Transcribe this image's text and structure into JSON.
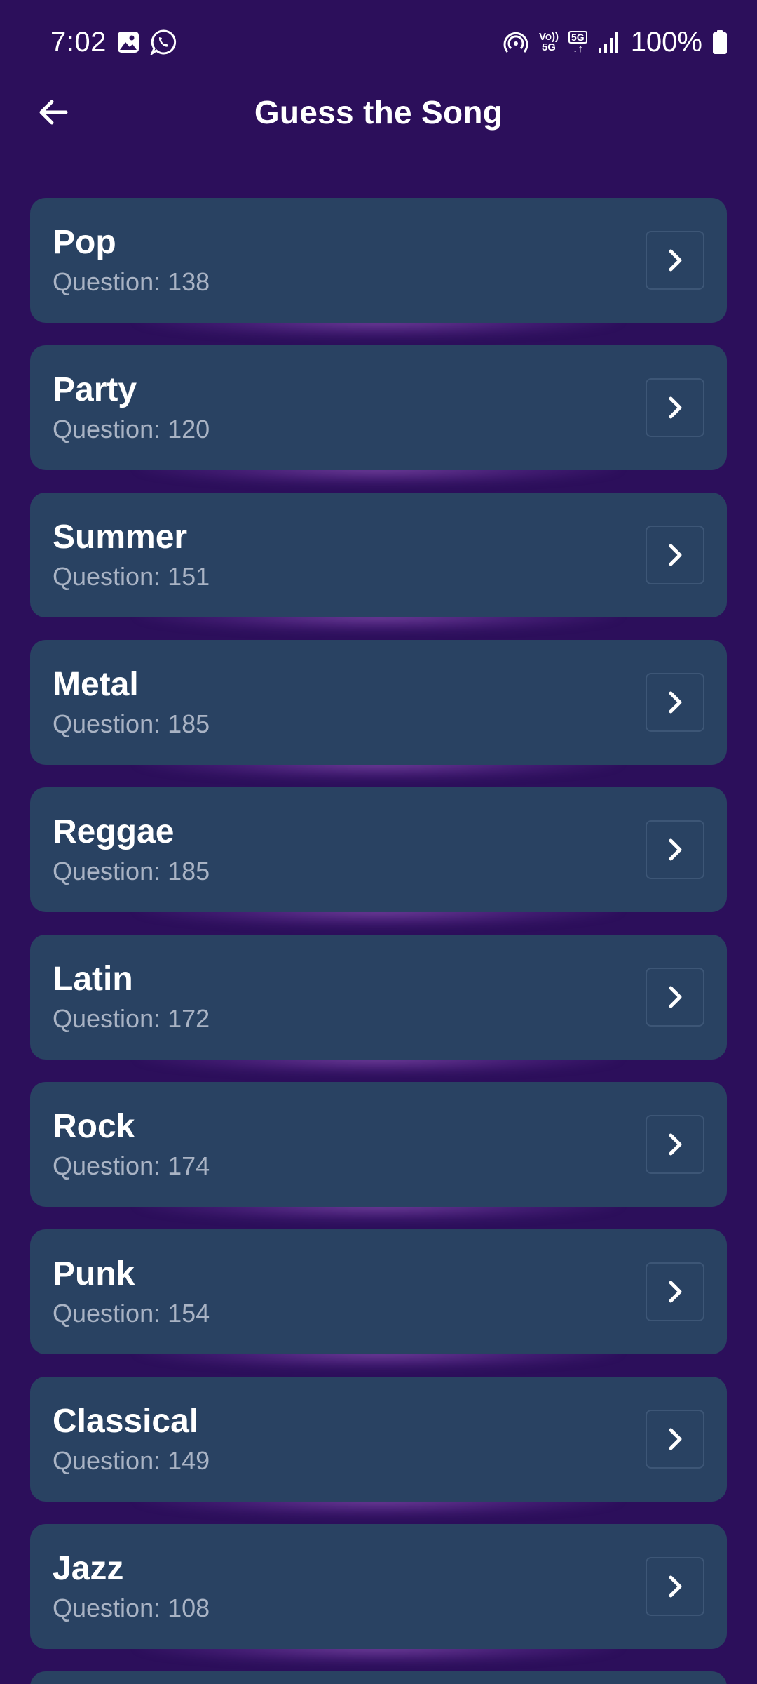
{
  "status_bar": {
    "time": "7:02",
    "battery_text": "100%",
    "volte_top": "Vo))",
    "volte_bottom": "5G",
    "net_type": "5G",
    "net_arrows": "↓↑"
  },
  "app_bar": {
    "title": "Guess the Song"
  },
  "question_label": "Question",
  "categories": [
    {
      "name": "Pop",
      "count": "138"
    },
    {
      "name": "Party",
      "count": "120"
    },
    {
      "name": "Summer",
      "count": "151"
    },
    {
      "name": "Metal",
      "count": "185"
    },
    {
      "name": "Reggae",
      "count": "185"
    },
    {
      "name": "Latin",
      "count": "172"
    },
    {
      "name": "Rock",
      "count": "174"
    },
    {
      "name": "Punk",
      "count": "154"
    },
    {
      "name": "Classical",
      "count": "149"
    },
    {
      "name": "Jazz",
      "count": "108"
    }
  ],
  "colors": {
    "background": "#2c0f5b",
    "card": "#294262",
    "subtitle": "#a9b3c4"
  }
}
